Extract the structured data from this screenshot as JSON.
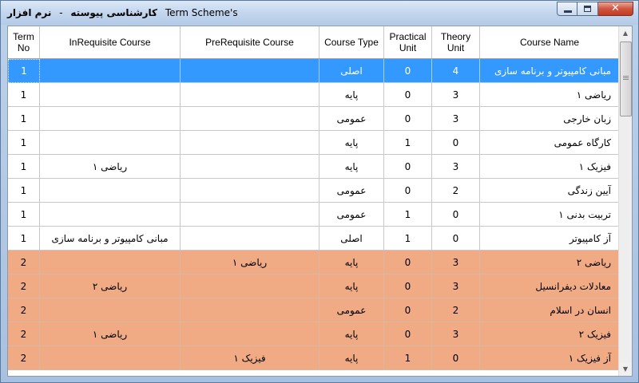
{
  "window": {
    "title_parts": [
      "Term Scheme's",
      "نرم افزار",
      "-",
      "کارشناسی پیوسته"
    ],
    "controls": {
      "minimize": "minimize-icon",
      "maximize": "maximize-icon",
      "close": "close-icon"
    }
  },
  "grid": {
    "headers": {
      "term_no": "Term No",
      "inrequisite": "InRequisite Course",
      "prerequisite": "PreRequisite Course",
      "course_type": "Course Type",
      "practical_unit": "Practical Unit",
      "theory_unit": "Theory Unit",
      "course_name": "Course Name"
    },
    "colors": {
      "selected": "#3399ff",
      "term1": "#ffffff",
      "term2": "#f0ab84"
    },
    "rows": [
      {
        "term": "1",
        "inreq": "",
        "prereq": "",
        "type": "اصلی",
        "practical": "0",
        "theory": "4",
        "name": "مبانی کامپیوتر و برنامه سازی"
      },
      {
        "term": "1",
        "inreq": "",
        "prereq": "",
        "type": "پایه",
        "practical": "0",
        "theory": "3",
        "name": "ریاضی ۱"
      },
      {
        "term": "1",
        "inreq": "",
        "prereq": "",
        "type": "عمومی",
        "practical": "0",
        "theory": "3",
        "name": "زبان خارجی"
      },
      {
        "term": "1",
        "inreq": "",
        "prereq": "",
        "type": "پایه",
        "practical": "1",
        "theory": "0",
        "name": "کارگاه عمومی"
      },
      {
        "term": "1",
        "inreq": "ریاضی ۱",
        "prereq": "",
        "type": "پایه",
        "practical": "0",
        "theory": "3",
        "name": "فیزیک ۱"
      },
      {
        "term": "1",
        "inreq": "",
        "prereq": "",
        "type": "عمومی",
        "practical": "0",
        "theory": "2",
        "name": "آیین زندگی"
      },
      {
        "term": "1",
        "inreq": "",
        "prereq": "",
        "type": "عمومی",
        "practical": "1",
        "theory": "0",
        "name": "تربیت بدنی ۱"
      },
      {
        "term": "1",
        "inreq": "مبانی کامپیوتر و برنامه سازی",
        "prereq": "",
        "type": "اصلی",
        "practical": "1",
        "theory": "0",
        "name": "آز کامپیوتر"
      },
      {
        "term": "2",
        "inreq": "",
        "prereq": "ریاضی ۱",
        "type": "پایه",
        "practical": "0",
        "theory": "3",
        "name": "ریاضی ۲"
      },
      {
        "term": "2",
        "inreq": "ریاضی ۲",
        "prereq": "",
        "type": "پایه",
        "practical": "0",
        "theory": "3",
        "name": "معادلات دیفرانسیل"
      },
      {
        "term": "2",
        "inreq": "",
        "prereq": "",
        "type": "عمومی",
        "practical": "0",
        "theory": "2",
        "name": "انسان در اسلام"
      },
      {
        "term": "2",
        "inreq": "ریاضی ۱",
        "prereq": "",
        "type": "پایه",
        "practical": "0",
        "theory": "3",
        "name": "فیزیک ۲"
      },
      {
        "term": "2",
        "inreq": "",
        "prereq": "فیزیک ۱",
        "type": "پایه",
        "practical": "1",
        "theory": "0",
        "name": "آز فیزیک ۱"
      }
    ]
  }
}
